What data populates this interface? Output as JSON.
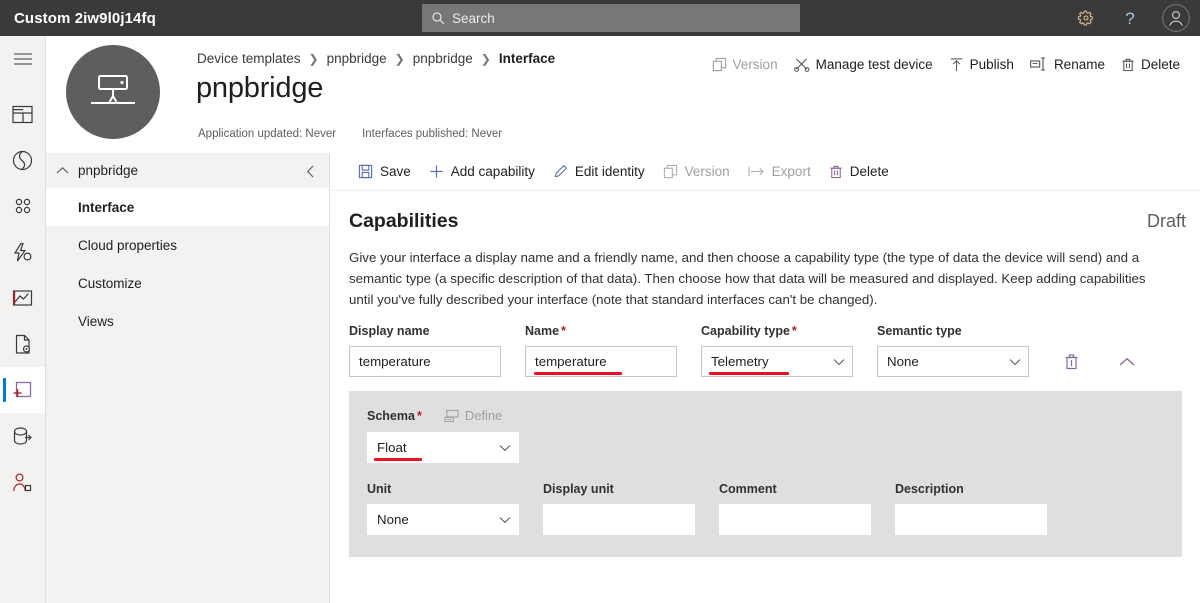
{
  "topbar": {
    "app_title": "Custom 2iw9l0j14fq",
    "search": {
      "placeholder": "Search",
      "icon": "search-icon"
    },
    "settings_icon": "gear-icon",
    "help_icon": "question-mark-icon",
    "account_icon": "user-avatar-icon"
  },
  "rail": {
    "items": [
      {
        "name": "hamburger-menu",
        "icon": "hamburger-icon"
      },
      {
        "name": "dashboard",
        "icon": "dashboard-icon"
      },
      {
        "name": "connect",
        "icon": "connect-ring-icon"
      },
      {
        "name": "devices",
        "icon": "devices-dots-icon"
      },
      {
        "name": "rules",
        "icon": "lightning-rules-icon"
      },
      {
        "name": "analytics",
        "icon": "analytics-chart-icon"
      },
      {
        "name": "jobs",
        "icon": "jobs-document-gear-icon"
      },
      {
        "name": "device-templates",
        "icon": "device-template-plus-icon",
        "selected": true
      },
      {
        "name": "data-export",
        "icon": "data-export-icon"
      },
      {
        "name": "administration",
        "icon": "administration-person-icon"
      }
    ]
  },
  "header": {
    "avatar_icon": "gateway-device-icon",
    "breadcrumb": [
      "Device templates",
      "pnpbridge",
      "pnpbridge",
      "Interface"
    ],
    "title": "pnpbridge",
    "meta": {
      "application_updated": "Application updated: Never",
      "interfaces_published": "Interfaces published: Never"
    },
    "actions": [
      {
        "label": "Version",
        "icon": "copy-version-icon",
        "disabled": true
      },
      {
        "label": "Manage test device",
        "icon": "manage-test-device-icon",
        "disabled": false
      },
      {
        "label": "Publish",
        "icon": "publish-up-arrow-icon",
        "disabled": false
      },
      {
        "label": "Rename",
        "icon": "rename-icon",
        "disabled": false
      },
      {
        "label": "Delete",
        "icon": "trash-icon",
        "disabled": false
      }
    ]
  },
  "inner_nav": {
    "group_label": "pnpbridge",
    "group_caret_icon": "chevron-up-icon",
    "collapse_icon": "chevron-left-icon",
    "items": [
      {
        "label": "Interface",
        "selected": true
      },
      {
        "label": "Cloud properties",
        "selected": false
      },
      {
        "label": "Customize",
        "selected": false
      },
      {
        "label": "Views",
        "selected": false
      }
    ]
  },
  "command_bar": {
    "buttons": [
      {
        "label": "Save",
        "icon": "save-disk-icon",
        "disabled": false
      },
      {
        "label": "Add capability",
        "icon": "plus-icon",
        "disabled": false
      },
      {
        "label": "Edit identity",
        "icon": "pencil-icon",
        "disabled": false
      },
      {
        "label": "Version",
        "icon": "copy-version-icon",
        "disabled": true
      },
      {
        "label": "Export",
        "icon": "export-arrow-icon",
        "disabled": true
      },
      {
        "label": "Delete",
        "icon": "trash-icon",
        "disabled": false
      }
    ]
  },
  "capabilities": {
    "section_title": "Capabilities",
    "status": "Draft",
    "description": "Give your interface a display name and a friendly name, and then choose a capability type (the type of data the device will send) and a semantic type (a specific description of that data). Then choose how that data will be measured and displayed. Keep adding capabilities until you've fully described your interface (note that standard interfaces can't be changed).",
    "row": {
      "display_name": {
        "label": "Display name",
        "required": false,
        "value": "temperature",
        "placeholder": ""
      },
      "name": {
        "label": "Name",
        "required": true,
        "value": "temperature",
        "placeholder": "",
        "annotated": true
      },
      "capability_type": {
        "label": "Capability type",
        "required": true,
        "value": "Telemetry",
        "annotated": true,
        "chevron": "chevron-down-icon"
      },
      "semantic_type": {
        "label": "Semantic type",
        "required": false,
        "value": "None",
        "annotated": false,
        "chevron": "chevron-down-icon"
      },
      "delete_icon": "trash-icon",
      "collapse_icon": "chevron-up-icon"
    },
    "schema_panel": {
      "schema": {
        "label": "Schema",
        "required": true,
        "value": "Float",
        "annotated": true,
        "chevron": "chevron-down-icon"
      },
      "define": {
        "label": "Define",
        "icon": "define-schema-icon",
        "disabled": true
      },
      "unit": {
        "label": "Unit",
        "value": "None",
        "chevron": "chevron-down-icon"
      },
      "display_unit": {
        "label": "Display unit",
        "value": "",
        "placeholder": ""
      },
      "comment": {
        "label": "Comment",
        "value": "",
        "placeholder": ""
      },
      "description": {
        "label": "Description",
        "value": "",
        "placeholder": ""
      }
    }
  },
  "colors": {
    "topbar_bg": "#3b3a39",
    "accent": "#0078d4",
    "annotation_red": "#e81123",
    "required_red": "#a4262c",
    "panel_grey": "#e1dfdd",
    "rail_grey": "#f3f2f1"
  }
}
